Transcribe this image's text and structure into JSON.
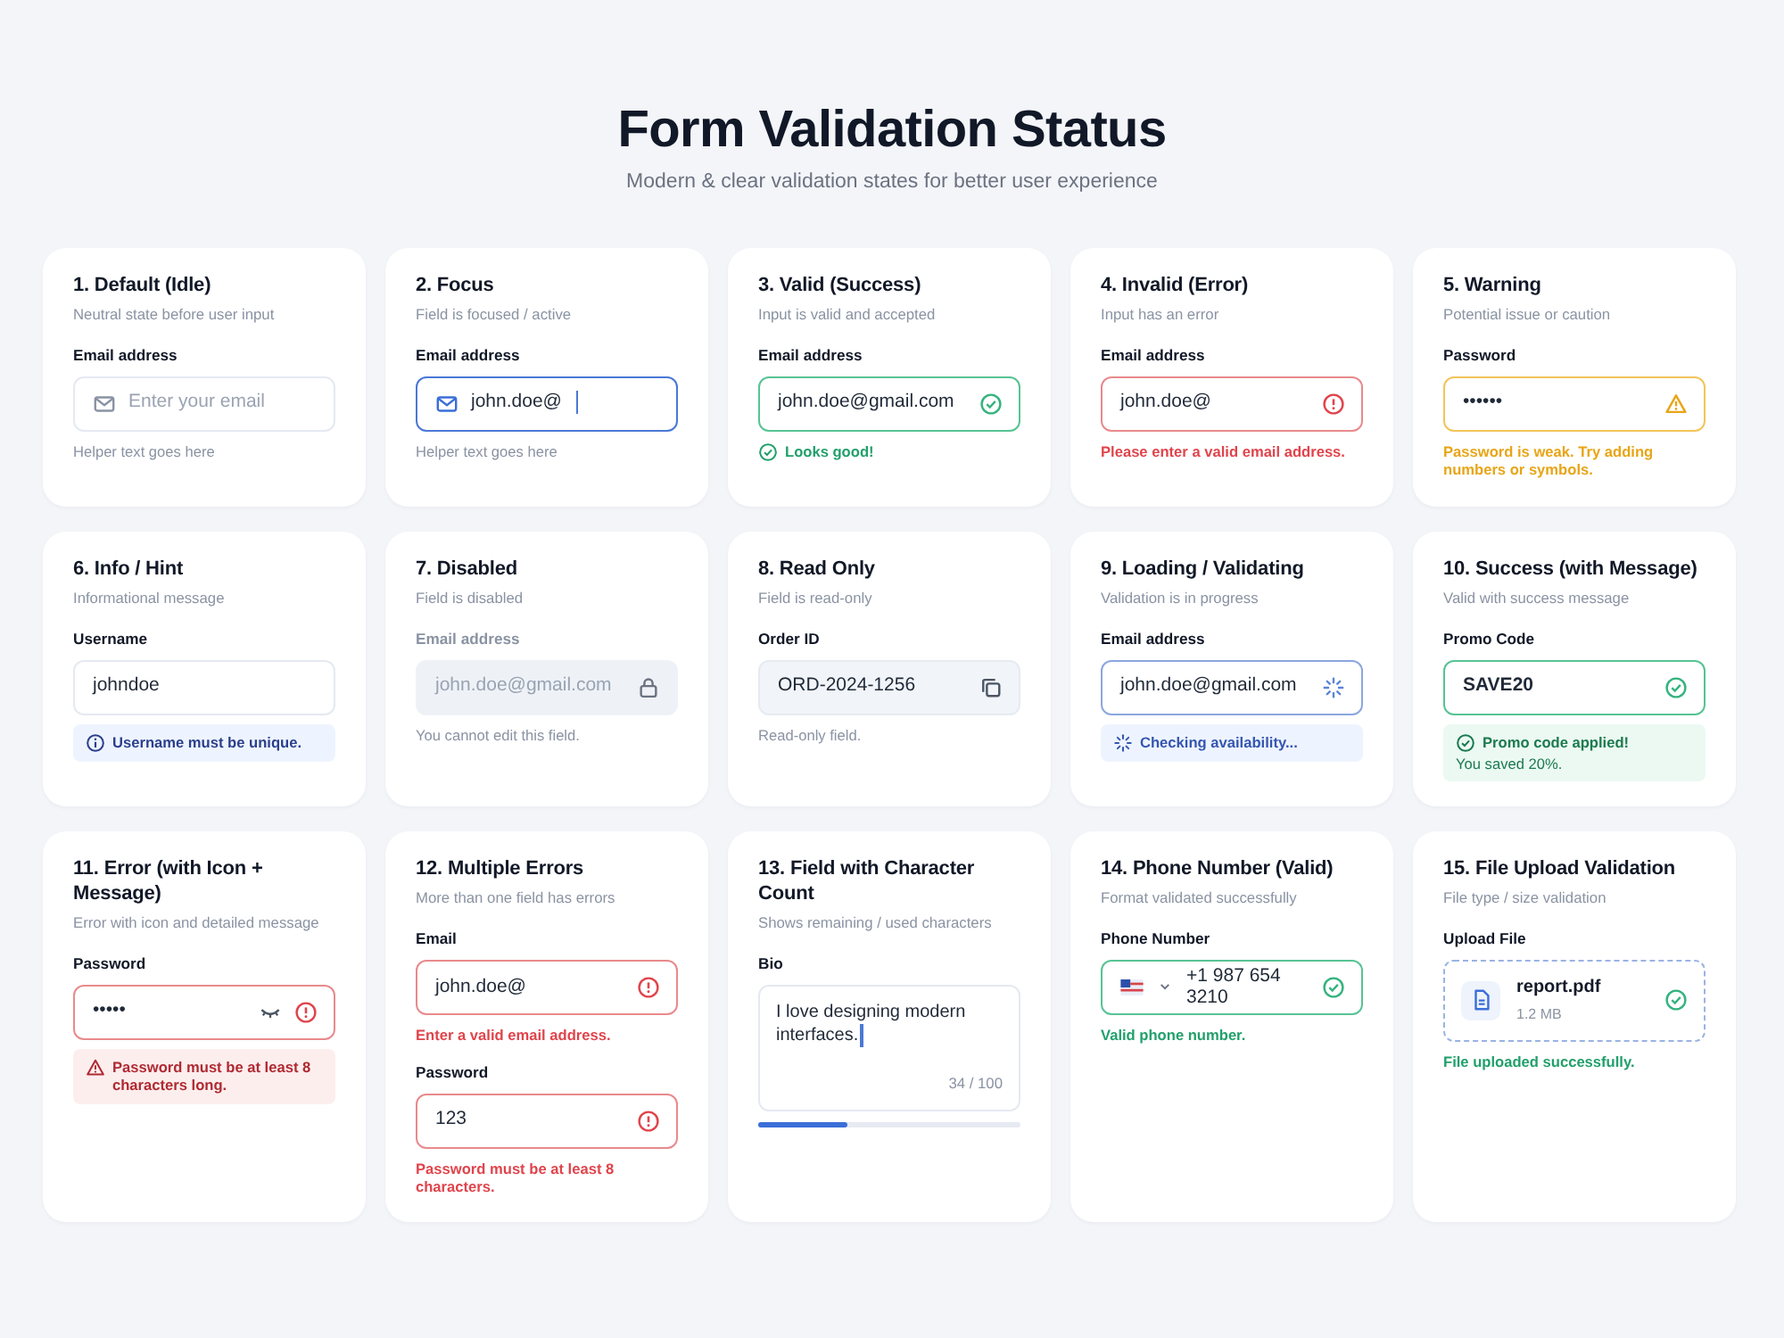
{
  "header": {
    "title": "Form Validation Status",
    "subtitle": "Modern & clear validation states for better user experience"
  },
  "cards": [
    {
      "title": "1. Default (Idle)",
      "subtitle": "Neutral state before user input",
      "fields": [
        {
          "kind": "mail-input",
          "label": "Email address",
          "placeholder": "Enter your email",
          "state": {
            "kind": "default"
          },
          "messages": [
            {
              "kind": "helper",
              "text": "Helper text goes here"
            }
          ]
        }
      ]
    },
    {
      "title": "2. Focus",
      "subtitle": "Field is focused / active",
      "fields": [
        {
          "kind": "mail-input",
          "label": "Email address",
          "value": "john.doe@",
          "state": {
            "kind": "focused"
          },
          "messages": [
            {
              "kind": "helper",
              "text": "Helper text goes here"
            }
          ]
        }
      ]
    },
    {
      "title": "3. Valid (Success)",
      "subtitle": "Input is valid and accepted",
      "fields": [
        {
          "kind": "input",
          "label": "Email address",
          "value": "john.doe@gmail.com",
          "state": {
            "kind": "valid"
          },
          "messages": [
            {
              "kind": "success-icon",
              "text": "Looks good!"
            }
          ]
        }
      ]
    },
    {
      "title": "4. Invalid (Error)",
      "subtitle": "Input has an error",
      "fields": [
        {
          "kind": "input",
          "label": "Email address",
          "value": "john.doe@",
          "state": {
            "kind": "invalid"
          },
          "messages": [
            {
              "kind": "error",
              "text": "Please enter a valid email address."
            }
          ]
        }
      ]
    },
    {
      "title": "5. Warning",
      "subtitle": "Potential issue or caution",
      "fields": [
        {
          "kind": "input",
          "label": "Password",
          "value": "••••••",
          "state": {
            "kind": "warning"
          },
          "messages": [
            {
              "kind": "warning",
              "text": "Password is weak. Try adding numbers or symbols."
            }
          ]
        }
      ]
    },
    {
      "title": "6. Info / Hint",
      "subtitle": "Informational message",
      "fields": [
        {
          "kind": "input",
          "label": "Username",
          "value": "johndoe",
          "state": {
            "kind": "default"
          },
          "messages": [
            {
              "kind": "info-box",
              "text": "Username must be unique."
            }
          ]
        }
      ]
    },
    {
      "title": "7. Disabled",
      "subtitle": "Field is disabled",
      "fields": [
        {
          "kind": "input",
          "label": "Email address",
          "value": "john.doe@gmail.com",
          "state": {
            "kind": "disabled"
          },
          "messages": [
            {
              "kind": "helper",
              "text": "You cannot edit this field."
            }
          ]
        }
      ]
    },
    {
      "title": "8. Read Only",
      "subtitle": "Field is read-only",
      "fields": [
        {
          "kind": "input",
          "label": "Order ID",
          "value": "ORD-2024-1256",
          "state": {
            "kind": "read-only"
          },
          "messages": [
            {
              "kind": "helper",
              "text": "Read-only field."
            }
          ]
        }
      ]
    },
    {
      "title": "9. Loading / Validating",
      "subtitle": "Validation is in progress",
      "fields": [
        {
          "kind": "input",
          "label": "Email address",
          "value": "john.doe@gmail.com",
          "state": {
            "kind": "loading"
          },
          "messages": [
            {
              "kind": "loading-box",
              "text": "Checking availability..."
            }
          ]
        }
      ]
    },
    {
      "title": "10. Success (with Message)",
      "subtitle": "Valid with success message",
      "fields": [
        {
          "kind": "code-input",
          "label": "Promo Code",
          "value": "SAVE20",
          "state": {
            "kind": "valid"
          },
          "messages": [
            {
              "kind": "success-box",
              "text": "Promo code applied!",
              "detail": "You saved 20%."
            }
          ]
        }
      ]
    },
    {
      "title": "11. Error (with Icon + Message)",
      "subtitle": "Error with icon and detailed message",
      "fields": [
        {
          "kind": "password-toggle",
          "label": "Password",
          "value": "•••••",
          "state": {
            "kind": "invalid"
          },
          "messages": [
            {
              "kind": "error-box",
              "text": "Password must be at least 8 characters long."
            }
          ]
        }
      ]
    },
    {
      "title": "12. Multiple Errors",
      "subtitle": "More than one field has errors",
      "fields": [
        {
          "kind": "input",
          "label": "Email",
          "value": "john.doe@",
          "state": {
            "kind": "invalid"
          },
          "messages": [
            {
              "kind": "error",
              "text": "Enter a valid email address."
            }
          ]
        },
        {
          "kind": "input",
          "label": "Password",
          "value": "123",
          "state": {
            "kind": "invalid"
          },
          "messages": [
            {
              "kind": "error",
              "text": "Password must be at least 8 characters."
            }
          ]
        }
      ]
    },
    {
      "title": "13. Field with Character Count",
      "subtitle": "Shows remaining / used characters",
      "fields": [
        {
          "kind": "textarea",
          "label": "Bio",
          "value": "I love designing modern interfaces.",
          "state": {
            "kind": "focused"
          },
          "counter": "34 / 100",
          "level": 0.34
        }
      ]
    },
    {
      "title": "14. Phone Number (Valid)",
      "subtitle": "Format validated successfully",
      "fields": [
        {
          "kind": "phone",
          "label": "Phone Number",
          "value": "+1 987 654 3210",
          "state": {
            "kind": "valid"
          },
          "messages": [
            {
              "kind": "success",
              "text": "Valid phone number."
            }
          ]
        }
      ]
    },
    {
      "title": "15. File Upload Validation",
      "subtitle": "File type / size validation",
      "fields": [
        {
          "kind": "upload",
          "label": "Upload File",
          "file_name": "report.pdf",
          "file_size": "1.2 MB",
          "state": {
            "kind": "valid"
          },
          "messages": [
            {
              "kind": "success",
              "text": "File uploaded successfully."
            }
          ]
        }
      ]
    }
  ]
}
